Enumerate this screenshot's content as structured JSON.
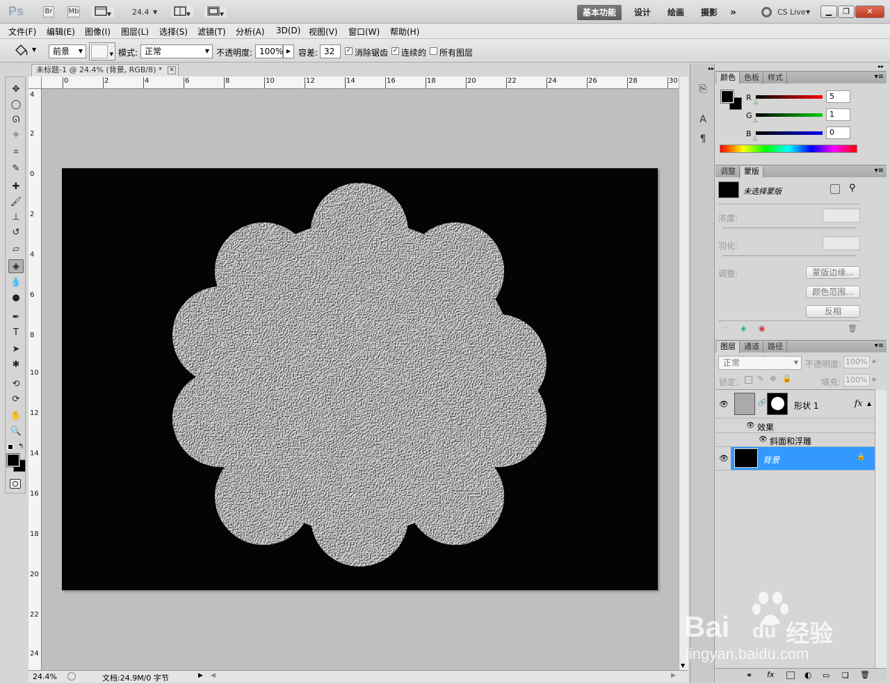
{
  "app": {
    "logo": "Ps",
    "bridge_label": "Br",
    "minibridge_label": "Mb",
    "zoom_value": "24.4",
    "workspaces": [
      "基本功能",
      "设计",
      "绘画",
      "摄影"
    ],
    "more_label": "»",
    "cslive_label": "CS Live"
  },
  "menu": [
    "文件(F)",
    "编辑(E)",
    "图像(I)",
    "图层(L)",
    "选择(S)",
    "滤镜(T)",
    "分析(A)",
    "3D(D)",
    "视图(V)",
    "窗口(W)",
    "帮助(H)"
  ],
  "options": {
    "fill_source": "前景",
    "mode_label": "模式:",
    "mode_value": "正常",
    "opacity_label": "不透明度:",
    "opacity_value": "100%",
    "tolerance_label": "容差:",
    "tolerance_value": "32",
    "antialias_label": "消除锯齿",
    "antialias_checked": true,
    "contiguous_label": "连续的",
    "contiguous_checked": true,
    "alllayers_label": "所有图层",
    "alllayers_checked": false
  },
  "document": {
    "tab_title": "未标题-1 @ 24.4% (背景, RGB/8) *",
    "ruler_h_labels": [
      "0",
      "2",
      "4",
      "6",
      "8",
      "10",
      "12",
      "14",
      "16",
      "18",
      "20",
      "22",
      "24",
      "26",
      "28",
      "30"
    ],
    "ruler_v_labels": [
      "4",
      "2",
      "0",
      "2",
      "4",
      "6",
      "8",
      "10",
      "12",
      "14",
      "16",
      "18",
      "20",
      "22",
      "24"
    ],
    "status_zoom": "24.4%",
    "status_doc": "文档:24.9M/0 字节",
    "background_color": "#050303",
    "shape_color": "#a9a9a9"
  },
  "color_panel": {
    "tabs": [
      "颜色",
      "色板",
      "样式"
    ],
    "r_label": "R",
    "r_value": "5",
    "g_label": "G",
    "g_value": "1",
    "b_label": "B",
    "b_value": "0",
    "fg_color": "#050100",
    "bg_color": "#000000"
  },
  "masks_panel": {
    "tabs": [
      "调整",
      "蒙版"
    ],
    "mask_label": "未选择蒙版",
    "density_label": "浓度:",
    "feather_label": "羽化:",
    "refine_label": "调整:",
    "btn_edge": "蒙版边缘...",
    "btn_color_range": "颜色范围...",
    "btn_invert": "反相"
  },
  "layers_panel": {
    "tabs": [
      "图层",
      "通道",
      "路径"
    ],
    "blend_mode": "正常",
    "opacity_label": "不透明度:",
    "opacity_value": "100%",
    "lock_label": "锁定:",
    "fill_label": "填充:",
    "fill_value": "100%",
    "layers": [
      {
        "name": "形状 1",
        "fx_label": "fx",
        "effects_label": "效果",
        "effect_name": "斜面和浮雕"
      },
      {
        "name": "背景"
      }
    ],
    "selected_color": "#3399ff"
  },
  "watermark": {
    "brand_a": "Bai",
    "brand_b": "du",
    "brand_c": "经验",
    "url": "jingyan.baidu.com"
  }
}
